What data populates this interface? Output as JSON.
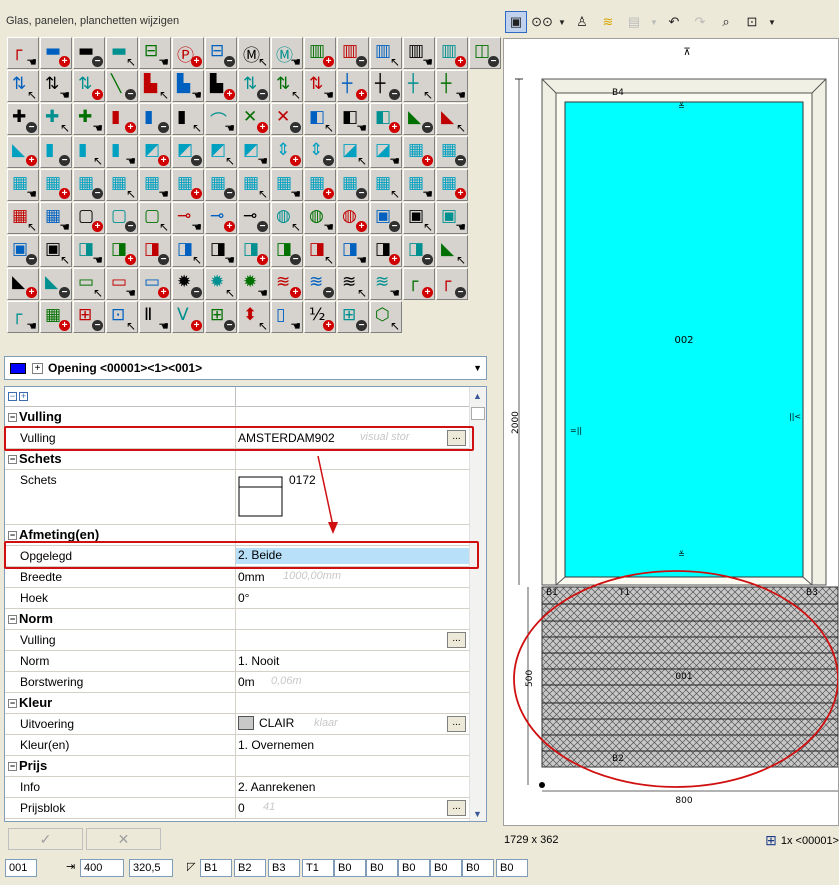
{
  "panel_title": "Glas, panelen, planchetten wijzigen",
  "selection": {
    "text": "Opening <00001><1><001>",
    "swatch_color": "#0000ff",
    "expander": "+"
  },
  "grid_header": {
    "collapse": "−",
    "expand": "+"
  },
  "properties": {
    "vulling_section": "Vulling",
    "vulling_label": "Vulling",
    "vulling_value": "AMSTERDAM902",
    "vulling_hint": "visual stor",
    "schets_section": "Schets",
    "schets_label": "Schets",
    "schets_value": "0172",
    "afmeting_section": "Afmeting(en)",
    "opgelegd_label": "Opgelegd",
    "opgelegd_value": "2. Beide",
    "breedte_label": "Breedte",
    "breedte_value": "0mm",
    "breedte_hint": "1000,00mm",
    "hoek_label": "Hoek",
    "hoek_value": "0°",
    "norm_section": "Norm",
    "norm_vulling_label": "Vulling",
    "norm_label": "Norm",
    "norm_value": "1. Nooit",
    "borstwering_label": "Borstwering",
    "borstwering_value": "0m",
    "borstwering_hint": "0,06m",
    "kleur_section": "Kleur",
    "uitvoering_label": "Uitvoering",
    "uitvoering_value": "CLAIR",
    "uitvoering_hint": "klaar",
    "kleuren_label": "Kleur(en)",
    "kleuren_value": "1. Overnemen",
    "prijs_section": "Prijs",
    "info_label": "Info",
    "info_value": "2. Aanrekenen",
    "prijsblok_label": "Prijsblok",
    "prijsblok_value": "0",
    "prijsblok_hint": "41",
    "ellipsis": "..."
  },
  "buttons": {
    "ok": "✓",
    "cancel": "✕"
  },
  "drawing": {
    "top_marker": "⊼",
    "label_b4": "B4",
    "label_002": "002",
    "label_2000": "2000",
    "label_500": "500",
    "label_800": "800",
    "label_b1": "B1",
    "label_t1": "T1",
    "label_b3": "B3",
    "label_001": "001",
    "label_b2": "B2",
    "glass_color": "#00ffff",
    "frame_color": "#e0e0c8",
    "annotation_color": "#d01010"
  },
  "status": {
    "size": "1729 x 362",
    "count": "1x <00001>"
  },
  "bottom": {
    "field1": "001",
    "field2": "400",
    "field3": "320,5",
    "f_b1": "B1",
    "f_b2": "B2",
    "f_b3": "B3",
    "f_t1": "T1",
    "f_b0a": "B0",
    "f_b0b": "B0",
    "f_b0c": "B0",
    "f_b0d": "B0",
    "f_b0e": "B0",
    "f_b0f": "B0"
  }
}
